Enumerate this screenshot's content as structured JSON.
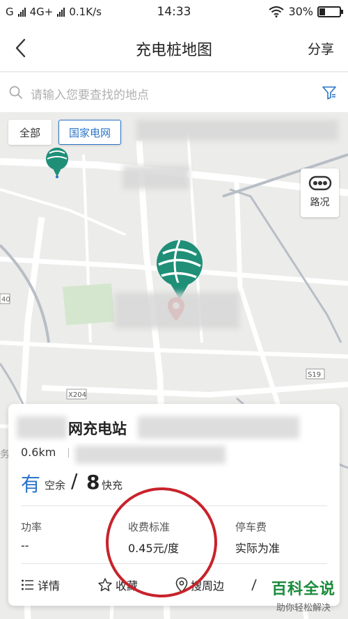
{
  "status_bar": {
    "carrier1": "G",
    "network": "4G+",
    "speed": "0.1K/s",
    "time": "14:33",
    "battery": "30%",
    "battery_level": 0.3
  },
  "header": {
    "title": "充电桩地图",
    "share_label": "分享"
  },
  "search": {
    "placeholder": "请输入您要查找的地点"
  },
  "filters": {
    "all_label": "全部",
    "grid_label": "国家电网"
  },
  "map": {
    "traffic_label": "路况",
    "road_labels": [
      "X204",
      "S19",
      "40",
      "务"
    ]
  },
  "station": {
    "name": "网充电站",
    "distance": "0.6km",
    "available_word": "有",
    "available_label": "空余",
    "slash": "/",
    "fast_count": "8",
    "fast_label": "快充",
    "stats": [
      {
        "label": "功率",
        "value": "--"
      },
      {
        "label": "收费标准",
        "value": "0.45元/度"
      },
      {
        "label": "停车费",
        "value": "实际为准"
      }
    ],
    "actions": [
      {
        "label": "详情",
        "icon": "list-icon"
      },
      {
        "label": "收藏",
        "icon": "star-icon"
      },
      {
        "label": "搜周边",
        "icon": "location-pin-icon"
      }
    ]
  },
  "watermark": {
    "title": "百科全说",
    "subtitle": "助你轻松解决"
  },
  "colors": {
    "accent": "#2a74c8",
    "marker_green": "#1f8f78",
    "pin_red": "#e84b4b",
    "annotation_red": "#c8222b",
    "watermark_green": "#1a8a3a"
  }
}
